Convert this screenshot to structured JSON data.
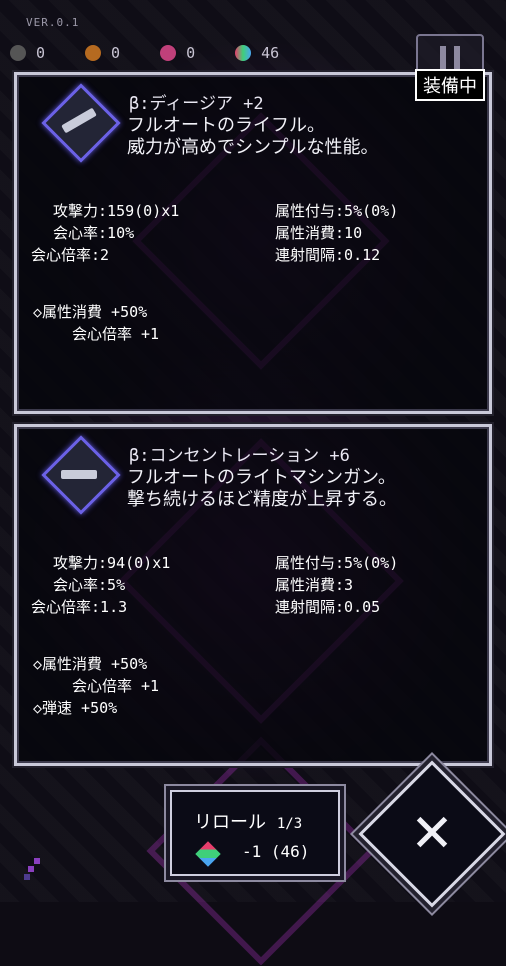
{
  "hud": {
    "version": "VER.0.1",
    "resources": [
      {
        "icon": "gem-icon",
        "color": "#666666",
        "value": "0"
      },
      {
        "icon": "gear-icon",
        "color": "#b56a20",
        "value": "0"
      },
      {
        "icon": "chip-icon",
        "color": "#c0407a",
        "value": "0"
      },
      {
        "icon": "cube-icon",
        "color": "#40b070",
        "value": "46"
      }
    ]
  },
  "cards": [
    {
      "name": "β:ディージア +2",
      "equipped_badge": "装備中",
      "desc1": "フルオートのライフル。",
      "desc2": "威力が高めでシンプルな性能。",
      "stats": [
        {
          "label": "攻撃力",
          "value": "159(0)x1"
        },
        {
          "label": "属性付与",
          "value": "5%(0%)"
        },
        {
          "label": "会心率",
          "value": "10%"
        },
        {
          "label": "属性消費",
          "value": "10"
        },
        {
          "label": "会心倍率",
          "value": "2"
        },
        {
          "label": "連射間隔",
          "value": "0.12"
        }
      ],
      "mods": [
        "◇属性消費 +50%",
        "　会心倍率 +1"
      ]
    },
    {
      "name": "β:コンセントレーション +6",
      "desc1": "フルオートのライトマシンガン。",
      "desc2": "撃ち続けるほど精度が上昇する。",
      "stats": [
        {
          "label": "攻撃力",
          "value": "94(0)x1"
        },
        {
          "label": "属性付与",
          "value": "5%(0%)"
        },
        {
          "label": "会心率",
          "value": "5%"
        },
        {
          "label": "属性消費",
          "value": "3"
        },
        {
          "label": "会心倍率",
          "value": "1.3"
        },
        {
          "label": "連射間隔",
          "value": "0.05"
        }
      ],
      "mods": [
        "◇属性消費 +50%",
        "　会心倍率 +1",
        "◇弾速 +50%"
      ]
    }
  ],
  "reroll": {
    "label": "リロール",
    "count": "1/3",
    "cost": "-1 (46)"
  },
  "close": {
    "glyph": "✕"
  },
  "colors": {
    "accent": "#6b61e6",
    "frame": "#c9c9d9",
    "glow": "#aa32be"
  }
}
